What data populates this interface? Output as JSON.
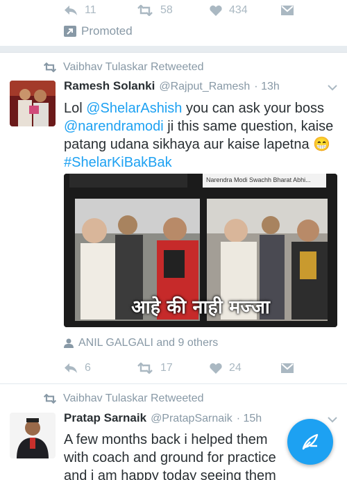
{
  "tweet_top": {
    "reply_count": "11",
    "retweet_count": "58",
    "like_count": "434",
    "promoted_label": "Promoted"
  },
  "tweet1": {
    "retweeted_by": "Vaibhav Tulaskar Retweeted",
    "author_name": "Ramesh Solanki",
    "author_handle": "@Rajput_Ramesh",
    "time": "· 13h",
    "text": {
      "prefix": "Lol ",
      "mention1": "@ShelarAshish",
      "part2": " you can ask your boss",
      "mention2": "@narendramodi",
      "part3": " ji this same question, kaise patang udana sikhaya aur kaise lapetna 😁",
      "hashtag": "#ShelarKiBakBak"
    },
    "media_strip_text": "Narendra Modi Swachh Bharat Abhi...",
    "media_caption": "आहे की नाही मज्जा",
    "liked_by": "ANIL GALGALI and 9 others",
    "reply_count": "6",
    "retweet_count": "17",
    "like_count": "24"
  },
  "tweet2": {
    "retweeted_by": "Vaibhav Tulaskar Retweeted",
    "author_name": "Pratap Sarnaik",
    "author_handle": "@PratapSarnaik",
    "time": "· 15h",
    "text": "A few months back i helped them with coach and ground for practice and i am happy today seeing them competing"
  },
  "colors": {
    "accent": "#1da1f2",
    "icon_gray": "#aab8c2",
    "meta_gray": "#8899a6",
    "text": "#292f33"
  },
  "icons": [
    "reply-icon",
    "retweet-icon",
    "like-icon",
    "direct-message-icon",
    "promoted-icon",
    "person-icon",
    "chevron-down-icon",
    "compose-icon"
  ]
}
